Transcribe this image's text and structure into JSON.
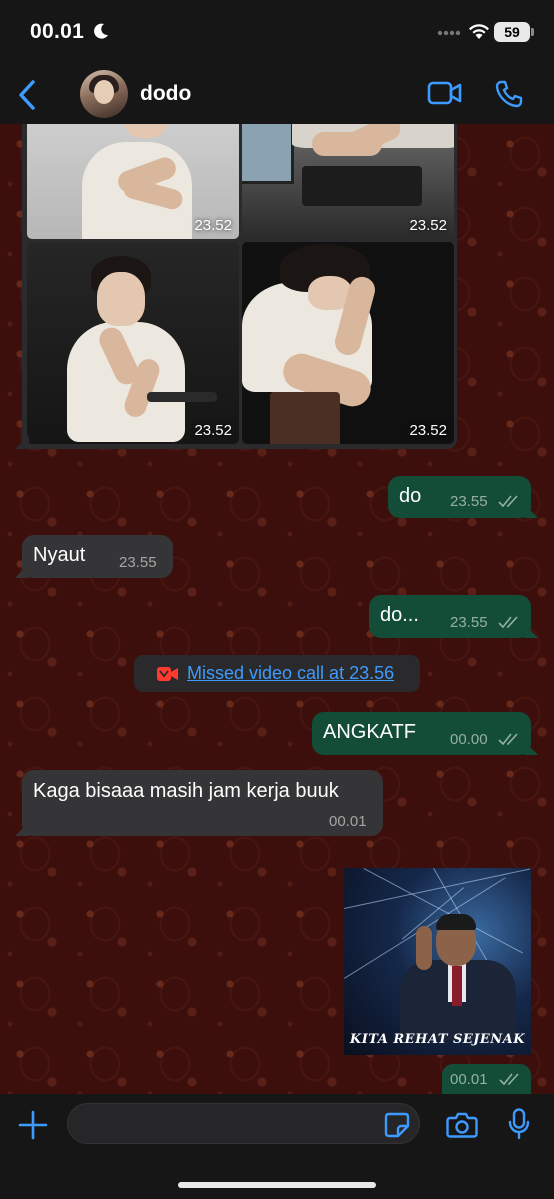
{
  "status_bar": {
    "time": "00.01",
    "battery": "59"
  },
  "header": {
    "contact_name": "dodo"
  },
  "album": {
    "timestamps": [
      "23.52",
      "23.52",
      "23.52",
      "23.52"
    ]
  },
  "messages": [
    {
      "direction": "outgoing",
      "text": "do",
      "time": "23.55",
      "status": "read"
    },
    {
      "direction": "incoming",
      "text": "Nyaut",
      "time": "23.55"
    },
    {
      "direction": "outgoing",
      "text": "do...",
      "time": "23.55",
      "status": "read"
    },
    {
      "direction": "system",
      "text": "Missed video call at 23.56",
      "icon": "missed-video-call-icon"
    },
    {
      "direction": "outgoing",
      "text": "ANGKATF",
      "time": "00.00",
      "status": "read"
    },
    {
      "direction": "incoming",
      "text": "Kaga bisaaa masih jam kerja buuk",
      "time": "00.01"
    },
    {
      "direction": "outgoing",
      "type": "sticker",
      "caption": "KITA REHAT SEJENAK",
      "time": "00.01",
      "status": "read"
    }
  ],
  "input": {
    "value": "",
    "placeholder": ""
  },
  "colors": {
    "accent": "#3d9bff",
    "outgoing_bubble": "#134d37",
    "incoming_bubble": "#353537",
    "missed_call_red": "#ff3b30"
  }
}
